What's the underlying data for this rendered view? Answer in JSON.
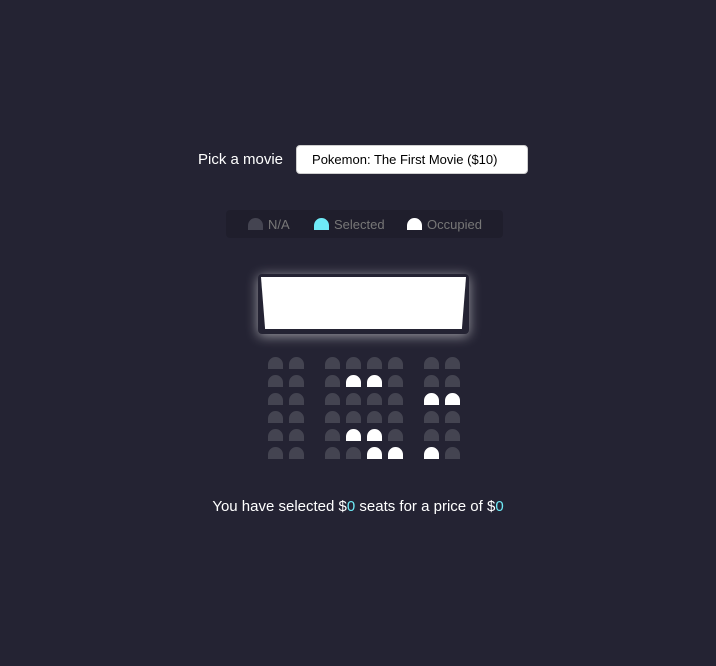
{
  "movie_picker": {
    "label": "Pick a movie",
    "selected_option": "Pokemon: The First Movie ($10)"
  },
  "legend": {
    "items": [
      {
        "label": "N/A",
        "state": "na"
      },
      {
        "label": "Selected",
        "state": "selected"
      },
      {
        "label": "Occupied",
        "state": "occupied"
      }
    ]
  },
  "seating": {
    "rows": 6,
    "columns": 8,
    "occupied": [
      [
        1,
        3
      ],
      [
        1,
        4
      ],
      [
        2,
        6
      ],
      [
        2,
        7
      ],
      [
        4,
        3
      ],
      [
        4,
        4
      ],
      [
        5,
        4
      ],
      [
        5,
        5
      ],
      [
        5,
        6
      ]
    ],
    "selected": []
  },
  "summary": {
    "prefix": "You have selected ",
    "seat_currency": "$",
    "seat_count": "0",
    "middle": " seats for a price of ",
    "price_currency": "$",
    "price": "0"
  },
  "colors": {
    "background": "#242333",
    "seat_na": "#444451",
    "seat_selected": "#6feaf6",
    "seat_occupied": "#ffffff",
    "accent": "#6feaf6"
  }
}
